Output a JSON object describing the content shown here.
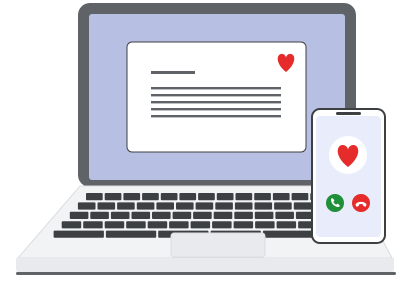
{
  "illustration": {
    "laptop": {
      "screen_card": {
        "heart_icon": "heart-icon",
        "line_count": 5
      },
      "keyboard": {
        "rows": 5
      }
    },
    "phone": {
      "heart_icon": "heart-icon",
      "accept_call_icon": "phone-accept-icon",
      "decline_call_icon": "phone-decline-icon"
    }
  },
  "colors": {
    "frame": "#5f6368",
    "screen_background": "#b7c0e2",
    "card": "#ffffff",
    "heart": "#e62b2b",
    "accept": "#1f8f3a",
    "decline": "#e62b2b",
    "phone_screen": "#e9edfb",
    "laptop_body": "#f1f3f4",
    "keys": "#3c4043"
  }
}
